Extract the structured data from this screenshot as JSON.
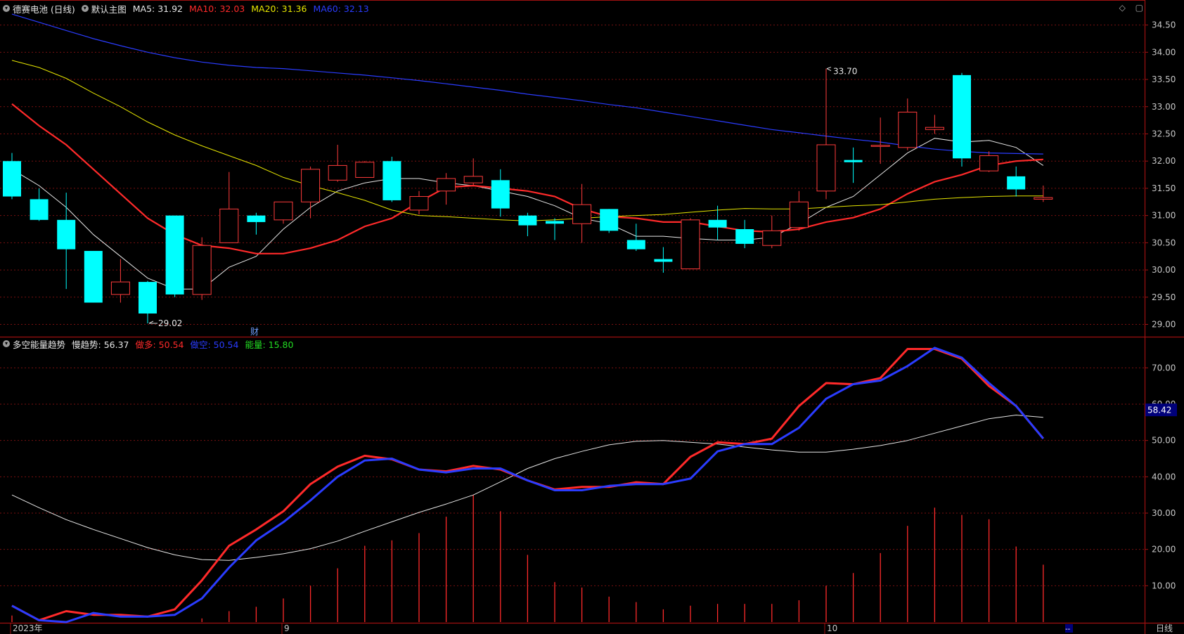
{
  "header": {
    "stock": "德赛电池 (日线)",
    "main_chart": "默认主图",
    "ma": [
      {
        "label": "MA5: 31.92",
        "color": "#e6e6e6"
      },
      {
        "label": "MA10: 32.03",
        "color": "#ff2a2a"
      },
      {
        "label": "MA20: 31.36",
        "color": "#e6e600"
      },
      {
        "label": "MA60: 32.13",
        "color": "#2a3cff"
      }
    ]
  },
  "sub_header": {
    "indicator": "多空能量趋势",
    "items": [
      {
        "label": "慢趋势: 56.37",
        "color": "#e6e6e6"
      },
      {
        "label": "做多: 50.54",
        "color": "#ff2a2a"
      },
      {
        "label": "做空: 50.54",
        "color": "#2a3cff"
      },
      {
        "label": "能量: 15.80",
        "color": "#22dd22"
      }
    ]
  },
  "annotations": {
    "high_label": "33.70",
    "low_label": "29.02",
    "event_marker": "财",
    "current_value": "58.42"
  },
  "x_axis": {
    "labels": [
      {
        "text": "2023年",
        "index": 0
      },
      {
        "text": "9",
        "index": 10
      },
      {
        "text": "10",
        "index": 30
      }
    ],
    "period_button": "日线",
    "scroll_marker": "--"
  },
  "colors": {
    "up": "#ff3b3b",
    "down": "#00ffff",
    "grid": "#7a1010",
    "axis_text": "#c8c8c8"
  },
  "chart_data": [
    {
      "type": "candlestick",
      "title": "德赛电池 (日线)",
      "ylim": [
        28.8,
        34.65
      ],
      "y_ticks": [
        29.0,
        29.5,
        30.0,
        30.5,
        31.0,
        31.5,
        32.0,
        32.5,
        33.0,
        33.5,
        34.0,
        34.5
      ],
      "candles": [
        {
          "o": 32.0,
          "h": 32.15,
          "l": 31.3,
          "c": 31.35
        },
        {
          "o": 31.3,
          "h": 31.5,
          "l": 30.9,
          "c": 30.92
        },
        {
          "o": 30.92,
          "h": 31.42,
          "l": 29.65,
          "c": 30.38
        },
        {
          "o": 30.35,
          "h": 30.35,
          "l": 29.4,
          "c": 29.4
        },
        {
          "o": 29.55,
          "h": 30.2,
          "l": 29.4,
          "c": 29.78
        },
        {
          "o": 29.78,
          "h": 29.8,
          "l": 29.02,
          "c": 29.2
        },
        {
          "o": 31.0,
          "h": 31.0,
          "l": 29.5,
          "c": 29.55
        },
        {
          "o": 29.55,
          "h": 30.6,
          "l": 29.45,
          "c": 30.45
        },
        {
          "o": 30.5,
          "h": 31.8,
          "l": 30.5,
          "c": 31.12
        },
        {
          "o": 31.0,
          "h": 31.05,
          "l": 30.65,
          "c": 30.88
        },
        {
          "o": 30.92,
          "h": 31.25,
          "l": 30.85,
          "c": 31.25
        },
        {
          "o": 31.25,
          "h": 31.9,
          "l": 30.95,
          "c": 31.85
        },
        {
          "o": 31.65,
          "h": 32.3,
          "l": 31.62,
          "c": 31.92
        },
        {
          "o": 31.7,
          "h": 32.0,
          "l": 31.7,
          "c": 31.98
        },
        {
          "o": 32.0,
          "h": 32.08,
          "l": 31.25,
          "c": 31.28
        },
        {
          "o": 31.1,
          "h": 31.45,
          "l": 31.02,
          "c": 31.35
        },
        {
          "o": 31.45,
          "h": 31.78,
          "l": 31.2,
          "c": 31.68
        },
        {
          "o": 31.6,
          "h": 32.05,
          "l": 31.55,
          "c": 31.72
        },
        {
          "o": 31.65,
          "h": 31.85,
          "l": 30.98,
          "c": 31.13
        },
        {
          "o": 31.0,
          "h": 31.05,
          "l": 30.62,
          "c": 30.82
        },
        {
          "o": 30.9,
          "h": 30.95,
          "l": 30.55,
          "c": 30.85
        },
        {
          "o": 30.85,
          "h": 31.58,
          "l": 30.5,
          "c": 31.2
        },
        {
          "o": 31.12,
          "h": 31.12,
          "l": 30.68,
          "c": 30.72
        },
        {
          "o": 30.55,
          "h": 30.85,
          "l": 30.35,
          "c": 30.38
        },
        {
          "o": 30.2,
          "h": 30.42,
          "l": 29.95,
          "c": 30.15
        },
        {
          "o": 30.02,
          "h": 30.95,
          "l": 30.02,
          "c": 30.92
        },
        {
          "o": 30.92,
          "h": 31.18,
          "l": 30.55,
          "c": 30.78
        },
        {
          "o": 30.75,
          "h": 30.92,
          "l": 30.4,
          "c": 30.48
        },
        {
          "o": 30.45,
          "h": 31.0,
          "l": 30.4,
          "c": 30.72
        },
        {
          "o": 30.78,
          "h": 31.45,
          "l": 30.72,
          "c": 31.25
        },
        {
          "o": 31.45,
          "h": 33.7,
          "l": 31.3,
          "c": 32.3
        },
        {
          "o": 32.02,
          "h": 32.25,
          "l": 31.6,
          "c": 31.98
        },
        {
          "o": 32.27,
          "h": 32.8,
          "l": 31.95,
          "c": 32.29
        },
        {
          "o": 32.25,
          "h": 33.15,
          "l": 32.2,
          "c": 32.9
        },
        {
          "o": 32.58,
          "h": 32.85,
          "l": 32.5,
          "c": 32.62
        },
        {
          "o": 33.58,
          "h": 33.62,
          "l": 31.9,
          "c": 32.05
        },
        {
          "o": 31.82,
          "h": 32.18,
          "l": 31.8,
          "c": 32.1
        },
        {
          "o": 31.72,
          "h": 31.9,
          "l": 31.35,
          "c": 31.48
        },
        {
          "o": 31.3,
          "h": 31.55,
          "l": 31.25,
          "c": 31.33
        }
      ],
      "series": [
        {
          "name": "MA5",
          "color": "#e6e6e6",
          "values": [
            31.85,
            31.55,
            31.15,
            30.65,
            30.25,
            29.85,
            29.65,
            29.65,
            30.05,
            30.25,
            30.75,
            31.15,
            31.45,
            31.6,
            31.68,
            31.68,
            31.6,
            31.55,
            31.45,
            31.35,
            31.18,
            30.95,
            30.85,
            30.62,
            30.62,
            30.58,
            30.55,
            30.55,
            30.6,
            30.85,
            31.15,
            31.35,
            31.75,
            32.15,
            32.42,
            32.35,
            32.38,
            32.25,
            31.92
          ]
        },
        {
          "name": "MA10",
          "color": "#ff2a2a",
          "values": [
            33.05,
            32.65,
            32.3,
            31.85,
            31.4,
            30.95,
            30.65,
            30.45,
            30.4,
            30.3,
            30.3,
            30.4,
            30.55,
            30.8,
            30.95,
            31.25,
            31.52,
            31.55,
            31.5,
            31.45,
            31.35,
            31.12,
            30.98,
            30.95,
            30.88,
            30.88,
            30.8,
            30.72,
            30.7,
            30.75,
            30.88,
            30.96,
            31.12,
            31.4,
            31.62,
            31.75,
            31.92,
            32.0,
            32.03
          ]
        },
        {
          "name": "MA20",
          "color": "#e6e600",
          "values": [
            33.85,
            33.72,
            33.52,
            33.25,
            33.0,
            32.72,
            32.48,
            32.28,
            32.1,
            31.92,
            31.7,
            31.55,
            31.42,
            31.28,
            31.1,
            31.0,
            30.98,
            30.95,
            30.92,
            30.9,
            30.92,
            30.95,
            30.98,
            31.0,
            31.02,
            31.06,
            31.1,
            31.13,
            31.12,
            31.12,
            31.15,
            31.18,
            31.2,
            31.25,
            31.3,
            31.33,
            31.35,
            31.36,
            31.36
          ]
        },
        {
          "name": "MA60",
          "color": "#2a3cff",
          "values": [
            34.7,
            34.55,
            34.4,
            34.25,
            34.12,
            34.0,
            33.9,
            33.82,
            33.76,
            33.72,
            33.7,
            33.66,
            33.62,
            33.58,
            33.53,
            33.48,
            33.42,
            33.36,
            33.3,
            33.23,
            33.17,
            33.11,
            33.04,
            32.98,
            32.9,
            32.82,
            32.74,
            32.66,
            32.58,
            32.52,
            32.46,
            32.4,
            32.35,
            32.28,
            32.22,
            32.18,
            32.15,
            32.14,
            32.13
          ]
        }
      ]
    },
    {
      "type": "line",
      "title": "多空能量趋势",
      "ylim": [
        0,
        78
      ],
      "y_ticks": [
        10.0,
        20.0,
        30.0,
        40.0,
        50.0,
        60.0,
        70.0
      ],
      "series": [
        {
          "name": "慢趋势",
          "color": "#e6e6e6",
          "values": [
            35,
            31.5,
            28.2,
            25.5,
            23.0,
            20.5,
            18.5,
            17.2,
            17.0,
            17.8,
            18.8,
            20.2,
            22.3,
            25.0,
            27.6,
            30.2,
            32.5,
            35.0,
            38.6,
            42.3,
            45.0,
            47.0,
            48.8,
            49.8,
            50.0,
            49.5,
            49.0,
            48.2,
            47.4,
            46.8,
            46.8,
            47.6,
            48.6,
            50.0,
            52.0,
            54.0,
            56.0,
            57.0,
            56.37
          ]
        },
        {
          "name": "做多",
          "color": "#ff2a2a",
          "values": [
            4.5,
            0.5,
            3.0,
            2.0,
            2.0,
            1.5,
            3.5,
            11.5,
            21.0,
            25.5,
            30.5,
            38.0,
            42.8,
            45.8,
            44.8,
            42.0,
            41.5,
            43.0,
            42.0,
            39.0,
            36.5,
            37.2,
            37.2,
            38.5,
            38.0,
            45.5,
            49.5,
            49.0,
            50.5,
            59.5,
            65.8,
            65.5,
            67.2,
            75.2,
            75.2,
            72.5,
            65.0,
            59.5,
            50.54
          ]
        },
        {
          "name": "做空",
          "color": "#2a3cff",
          "values": [
            4.5,
            0.5,
            0.0,
            2.5,
            1.5,
            1.5,
            2.0,
            6.5,
            15.0,
            22.5,
            27.5,
            33.5,
            40.0,
            44.5,
            45.0,
            42.0,
            41.2,
            42.3,
            42.3,
            39.0,
            36.3,
            36.3,
            37.5,
            38.0,
            38.0,
            39.5,
            47.0,
            49.0,
            49.0,
            53.5,
            61.5,
            65.5,
            66.5,
            70.5,
            75.5,
            72.8,
            65.8,
            59.5,
            50.54
          ]
        },
        {
          "name": "能量",
          "color": "#ff2a2a",
          "bars": true,
          "values": [
            1.8,
            0,
            0,
            0,
            0,
            0,
            0,
            1.0,
            3.0,
            4.2,
            6.5,
            10.0,
            14.8,
            21.0,
            22.5,
            24.5,
            29.0,
            35.0,
            30.5,
            18.5,
            11.0,
            9.5,
            7.0,
            5.5,
            3.5,
            4.5,
            5.0,
            5.0,
            5.0,
            6.0,
            10.0,
            13.5,
            19.0,
            26.5,
            31.5,
            29.5,
            28.3,
            20.8,
            15.8
          ]
        }
      ]
    }
  ]
}
